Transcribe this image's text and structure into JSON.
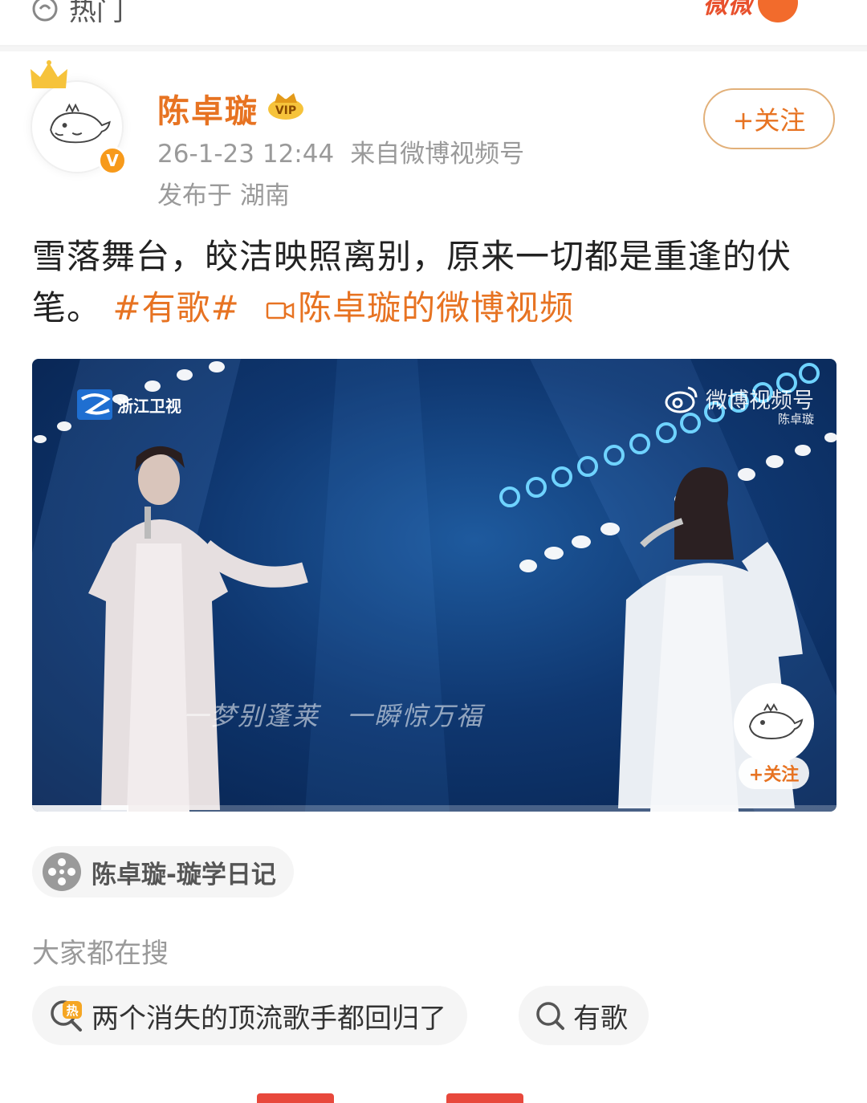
{
  "top_bar": {
    "hot_tab_label": "热门",
    "brand_stamp_text": "微微"
  },
  "post": {
    "author": {
      "name": "陈卓璇",
      "verified": true,
      "avatar_icon": "cartoon-whale-avatar"
    },
    "time": "26-1-23 12:44",
    "source": "来自微博视频号",
    "location": "发布于 湖南",
    "follow_label": "+关注",
    "text_body": "雪落舞台，皎洁映照离别，原来一切都是重逢的伏笔。",
    "hashtag": "#有歌#",
    "video_link_label": "陈卓璇的微博视频"
  },
  "video": {
    "channel_logo_text": "浙江卫视",
    "watermark": "微博视频号",
    "watermark_sub": "陈卓璇",
    "subtitle": "一梦别蓬莱　一瞬惊万福",
    "overlay_follow": "+关注",
    "progress": 0.12
  },
  "source_chip": {
    "label": "陈卓璇-璇学日记"
  },
  "related_search": {
    "heading": "大家都在搜",
    "items": [
      {
        "label": "两个消失的顶流歌手都回归了",
        "icon": "hot-search-icon"
      },
      {
        "label": "有歌",
        "icon": "search-icon"
      }
    ]
  },
  "colors": {
    "accent": "#e77322",
    "meta_gray": "#9a9a9a",
    "video_bg": "#0f3770"
  }
}
